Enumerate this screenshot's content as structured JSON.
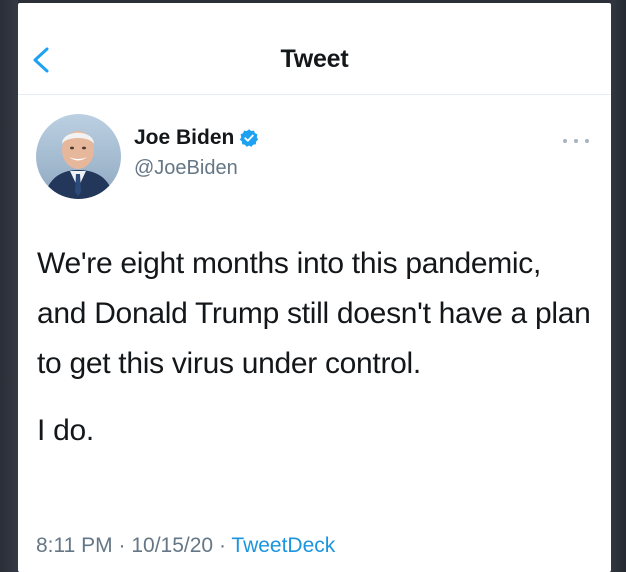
{
  "header": {
    "title": "Tweet",
    "back_icon": "chevron-left-icon"
  },
  "author": {
    "name": "Joe Biden",
    "handle": "@JoeBiden",
    "verified_icon": "verified-badge-icon",
    "avatar": "avatar-photo"
  },
  "tweet": {
    "paragraphs": [
      "We're eight months into this pandemic, and Donald Trump still doesn't have a plan to get this virus under control.",
      "I do."
    ],
    "time": "8:11 PM",
    "separator": "·",
    "date": "10/15/20",
    "source": "TweetDeck"
  },
  "colors": {
    "accent": "#1b95e0",
    "text": "#14171a",
    "secondary": "#657786",
    "backdrop": "#2b3038"
  }
}
